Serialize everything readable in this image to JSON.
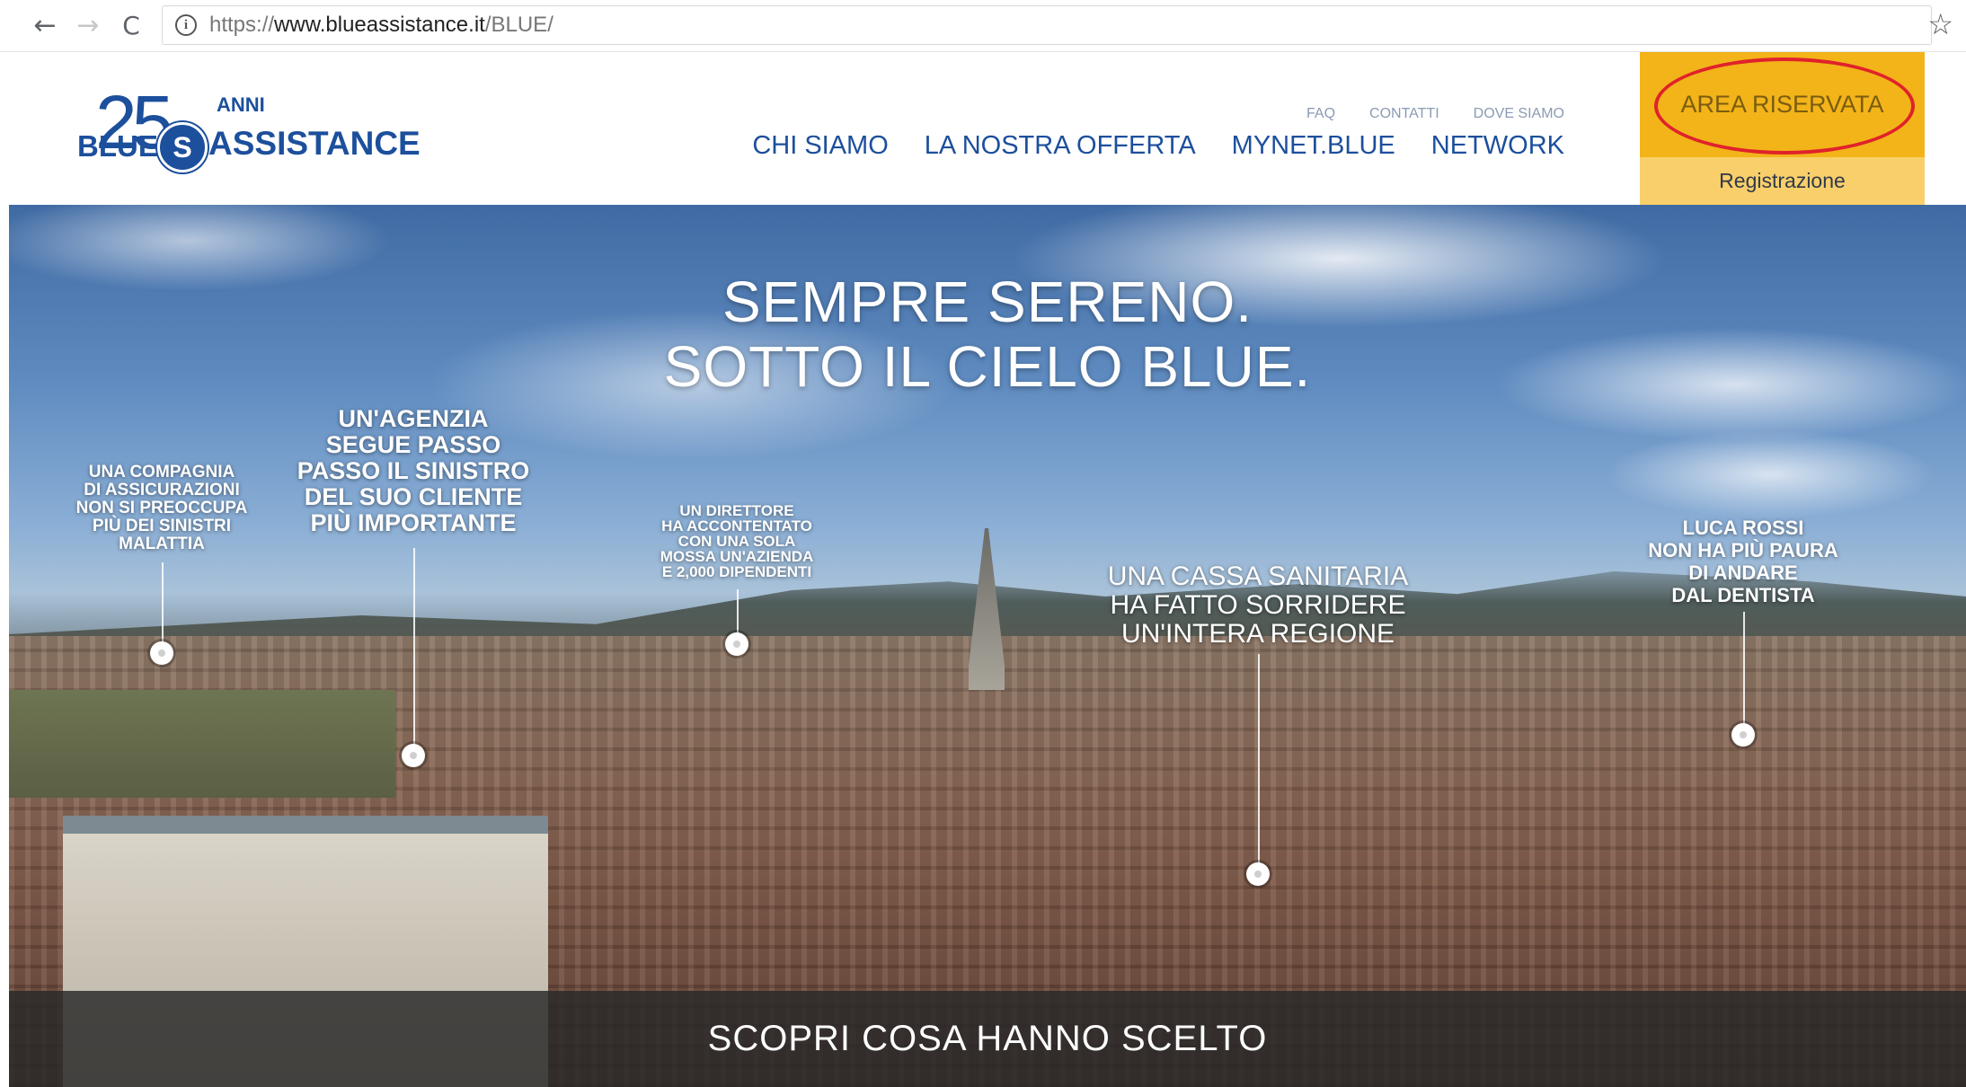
{
  "browser": {
    "back_icon": "←",
    "forward_icon": "→",
    "reload_icon": "C",
    "url_scheme": "https://",
    "url_host": "www.blueassistance.it",
    "url_path": "/BLUE/",
    "star_icon": "☆"
  },
  "logo": {
    "number": "25",
    "anni": "ANNI",
    "word1": "BLUE",
    "word2": "ASSISTANCE",
    "emblem": "S"
  },
  "header": {
    "small_links": [
      "FAQ",
      "CONTATTI",
      "DOVE SIAMO"
    ],
    "main_nav": [
      "CHI SIAMO",
      "LA NOSTRA OFFERTA",
      "MYNET.BLUE",
      "NETWORK"
    ],
    "area_riservata": "AREA RISERVATA",
    "registrazione": "Registrazione"
  },
  "hero": {
    "title_line1": "SEMPRE SERENO.",
    "title_line2": "SOTTO IL CIELO BLUE.",
    "callouts": [
      "UNA COMPAGNIA\nDI ASSICURAZIONI\nNON SI PREOCCUPA\nPIÙ DEI SINISTRI\nMALATTIA",
      "UN'AGENZIA\nSEGUE PASSO\nPASSO IL SINISTRO\nDEL SUO CLIENTE\nPIÙ IMPORTANTE",
      "UN DIRETTORE\nHA ACCONTENTATO\nCON UNA SOLA\nMOSSA UN'AZIENDA\nE 2,000 DIPENDENTI",
      "UNA CASSA SANITARIA\nHA FATTO SORRIDERE\nUN'INTERA REGIONE",
      "LUCA ROSSI\nNON HA PIÙ PAURA\nDI ANDARE\nDAL DENTISTA"
    ],
    "cta": "SCOPRI COSA HANNO SCELTO"
  },
  "colors": {
    "brand_blue": "#1c4f9c",
    "accent_yellow": "#f2b419",
    "highlight_red": "#e0222b"
  }
}
